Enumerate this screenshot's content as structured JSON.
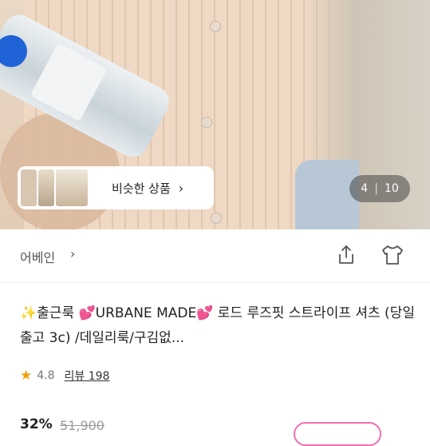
{
  "hero": {
    "similar_products_label": "비슷한 상품",
    "similar_products_chevron": "›",
    "image_counter": {
      "current": "4",
      "separator": "|",
      "total": "10"
    }
  },
  "store": {
    "name": "어베인",
    "chevron": "›",
    "share_icon": "share-icon",
    "try_on_icon": "shirt-outline-icon"
  },
  "product": {
    "title": "✨출근룩 💕URBANE MADE💕 로드 루즈핏 스트라이프 셔츠 (당일출고 3c) /데일리룩/구김없...",
    "rating": "4.8",
    "review_label": "리뷰 198"
  },
  "price": {
    "discount": "32%",
    "original": "51,900"
  },
  "colors": {
    "star": "#f2a007",
    "accent_pink": "#f26fb0",
    "counter_bg": "#464646"
  }
}
